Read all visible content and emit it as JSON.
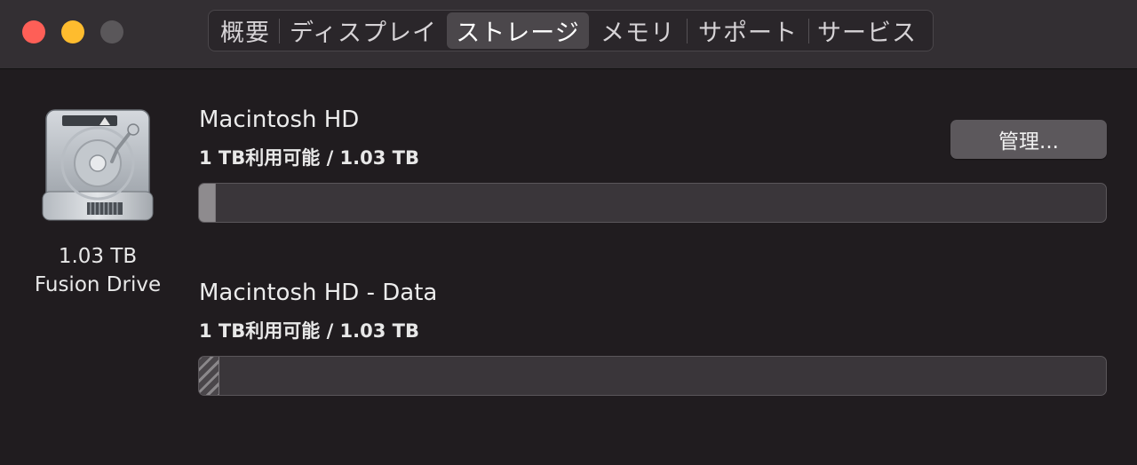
{
  "window": {
    "traffic_lights": [
      "close",
      "minimize",
      "zoom"
    ]
  },
  "tabs": [
    {
      "label": "概要",
      "active": false
    },
    {
      "label": "ディスプレイ",
      "active": false
    },
    {
      "label": "ストレージ",
      "active": true
    },
    {
      "label": "メモリ",
      "active": false
    },
    {
      "label": "サポート",
      "active": false
    },
    {
      "label": "サービス",
      "active": false
    }
  ],
  "drive": {
    "icon": "hard-drive-icon",
    "size": "1.03 TB",
    "type": "Fusion Drive"
  },
  "volumes": [
    {
      "name": "Macintosh HD",
      "info": "1 TB利用可能 / 1.03 TB",
      "used_fraction": 0.018,
      "pattern": "solid"
    },
    {
      "name": "Macintosh HD - Data",
      "info": "1 TB利用可能 / 1.03 TB",
      "used_fraction": 0.022,
      "pattern": "hatched"
    }
  ],
  "manage_button": {
    "label": "管理..."
  },
  "colors": {
    "close": "#fe5f57",
    "minimize": "#febc2e",
    "zoom_inactive": "#5a575a"
  }
}
